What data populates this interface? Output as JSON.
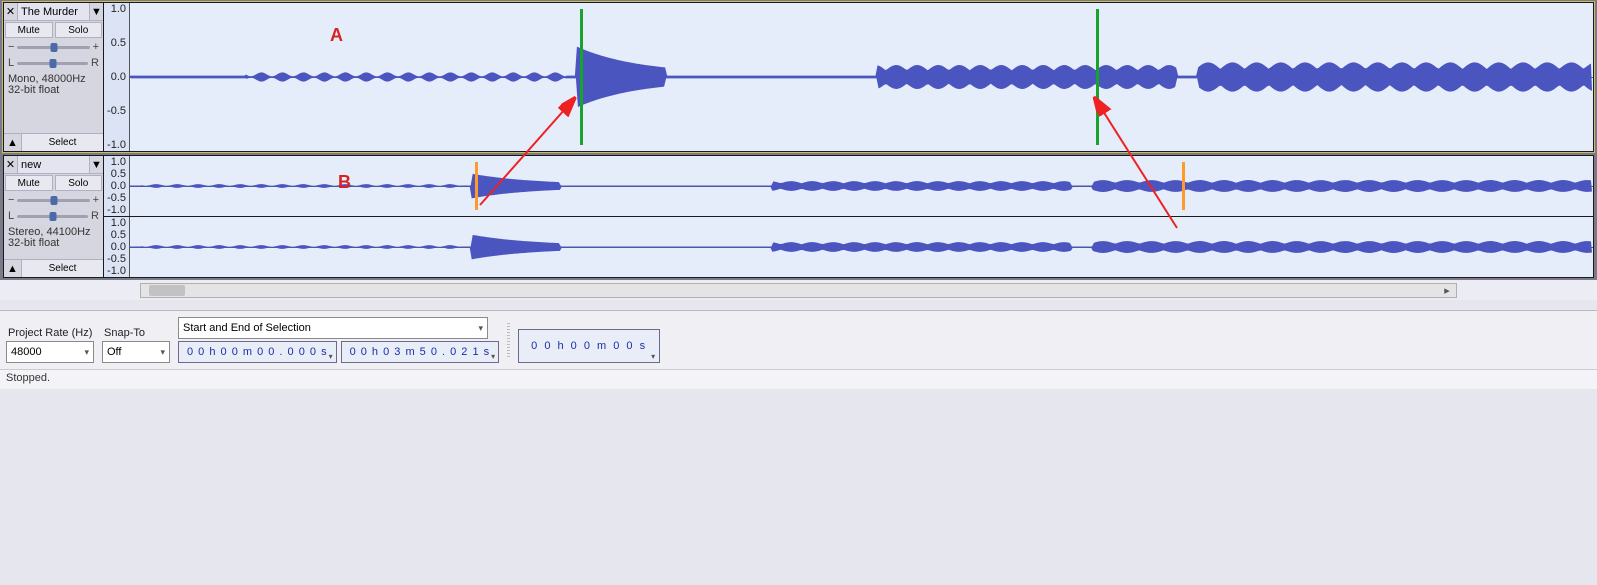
{
  "tracks": [
    {
      "name": "The Murder",
      "mute": "Mute",
      "solo": "Solo",
      "gain_left": "−",
      "gain_right": "+",
      "pan_left": "L",
      "pan_right": "R",
      "info_line1": "Mono, 48000Hz",
      "info_line2": "32-bit float",
      "select": "Select",
      "ruler": [
        "1.0",
        "0.5",
        "0.0",
        "-0.5",
        "-1.0"
      ],
      "annot_letter": "A",
      "markers_green": [
        575,
        1091
      ]
    },
    {
      "name": "new",
      "mute": "Mute",
      "solo": "Solo",
      "gain_left": "−",
      "gain_right": "+",
      "pan_left": "L",
      "pan_right": "R",
      "info_line1": "Stereo, 44100Hz",
      "info_line2": "32-bit float",
      "select": "Select",
      "ruler": [
        "1.0",
        "0.5",
        "0.0",
        "-0.5",
        "-1.0"
      ],
      "annot_letter": "B",
      "markers_orange": [
        470,
        1177
      ]
    }
  ],
  "controls": {
    "rate_label": "Project Rate (Hz)",
    "rate_value": "48000",
    "snap_label": "Snap-To",
    "snap_value": "Off",
    "sel_label": "Start and End of Selection",
    "sel_start": "0 0 h 0 0 m 0 0 . 0 0 0 s",
    "sel_end": "0 0 h 0 3 m 5 0 . 0 2 1 s",
    "big_time": "0 0 h 0 0 m 0 0 s"
  },
  "status": "Stopped."
}
